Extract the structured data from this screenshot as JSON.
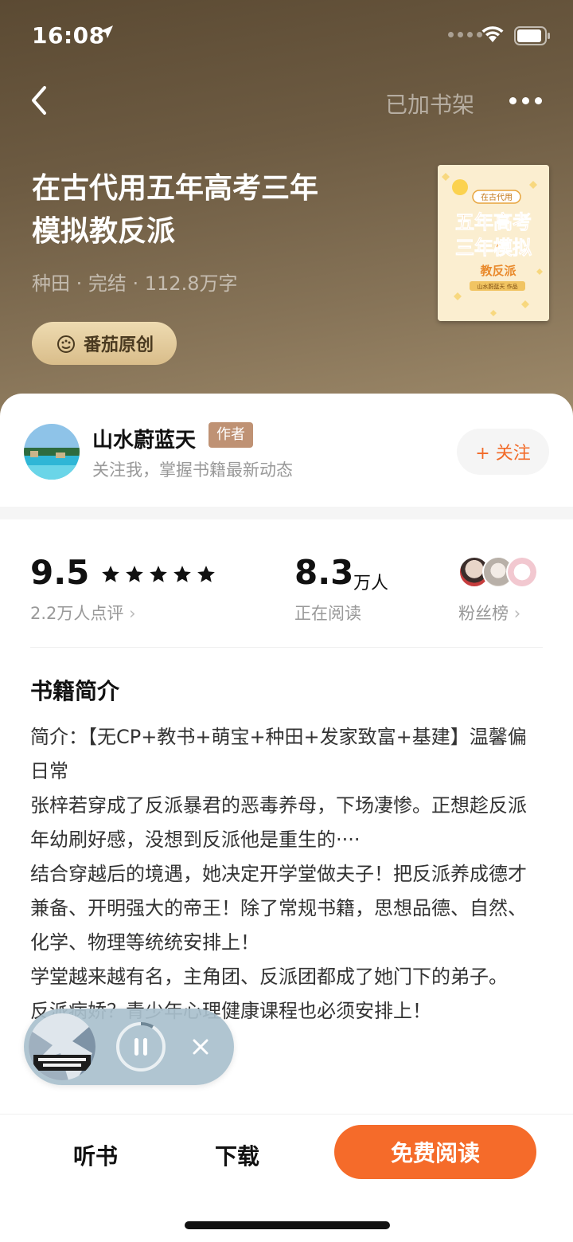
{
  "status_bar": {
    "time": "16:08"
  },
  "nav": {
    "shelf_label": "已加书架"
  },
  "book": {
    "title_line1": "在古代用五年高考三年",
    "title_line2": "模拟教反派",
    "meta": "种田 · 完结 · 112.8万字",
    "badge": "番茄原创",
    "cover": {
      "top_label": "在古代用",
      "line1": "五年高考",
      "line2": "三年模拟",
      "line3": "教反派",
      "author": "山水蔚蓝天 作品"
    }
  },
  "author": {
    "name": "山水蔚蓝天",
    "tag": "作者",
    "description": "关注我，掌握书籍最新动态",
    "follow_label": "+ 关注"
  },
  "stats": {
    "score": "9.5",
    "star_count": 5,
    "reviews": "2.2万人点评",
    "reading_count": "8.3",
    "reading_unit": "万人",
    "reading_label": "正在阅读",
    "fans_label": "粉丝榜"
  },
  "intro": {
    "section_title": "书籍简介",
    "paragraphs": [
      "简介：【无CP+教书+萌宝+种田+发家致富+基建】温馨偏日常",
      "张梓若穿成了反派暴君的恶毒养母，下场凄惨。正想趁反派年幼刷好感，没想到反派他是重生的····",
      "结合穿越后的境遇，她决定开学堂做夫子！把反派养成德才兼备、开明强大的帝王！除了常规书籍，思想品德、自然、化学、物理等统统安排上！",
      "学堂越来越有名，主角团、反派团都成了她门下的弟子。",
      "反派病娇？青少年心理健康课程也必须安排上！",
      "*"
    ]
  },
  "bottom_bar": {
    "listen_label": "听书",
    "download_label": "下载",
    "read_label": "免费阅读"
  },
  "colors": {
    "accent": "#f56b2a",
    "author_tag": "#bf9274",
    "badge_gold": "#e6cfa0"
  }
}
